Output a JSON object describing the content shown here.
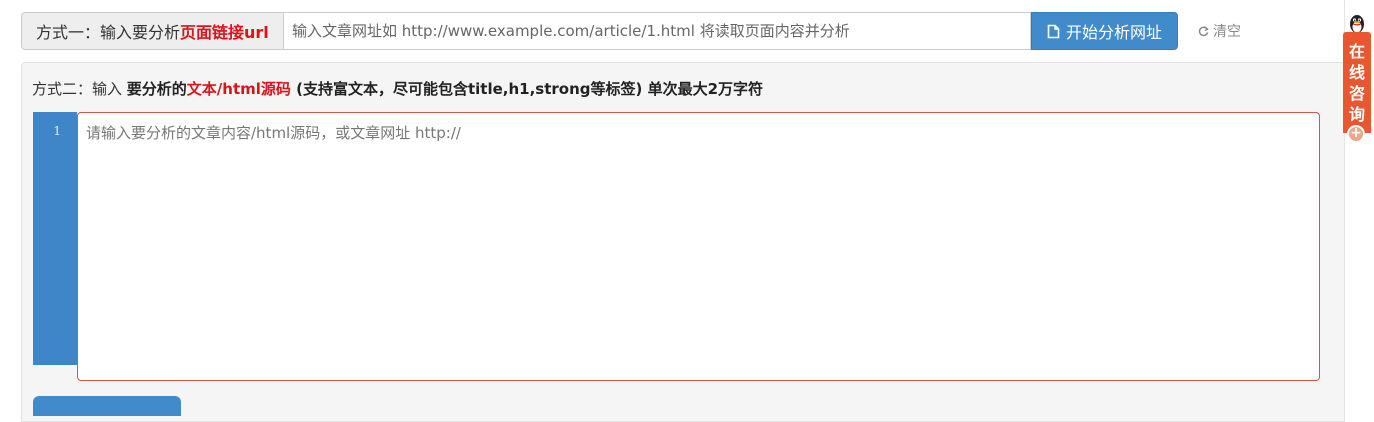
{
  "url_row": {
    "label_prefix": "方式一：输入要分析",
    "label_highlight": "页面链接url",
    "input_value": "",
    "input_placeholder": "输入文章网址如 http://www.example.com/article/1.html 将读取页面内容并分析",
    "analyze_button": "开始分析网址",
    "clear_link": "清空"
  },
  "method2": {
    "prefix": "方式二：输入 ",
    "bold1": "要分析的",
    "red": "文本/html源码",
    "bold2": " (支持富文本，尽可能包含title,h1,strong等标签) 单次最大2万字符"
  },
  "editor": {
    "line_number": "1",
    "value": "",
    "placeholder": "请输入要分析的文章内容/html源码，或文章网址 http://"
  },
  "side_widget": {
    "consult_chars": [
      "在",
      "线",
      "咨",
      "询"
    ],
    "plus": "+"
  },
  "icons": {
    "analyze_icon": "document-edit-icon",
    "clear_icon": "refresh-icon",
    "side_icon": "qq-penguin-icon",
    "expand_icon": "plus-circle-icon"
  },
  "colors": {
    "primary": "#428bca",
    "highlight_red": "#d9141a",
    "editor_border": "#d9534f",
    "consult_orange": "#e8572f",
    "gutter": "#3e86c8"
  }
}
